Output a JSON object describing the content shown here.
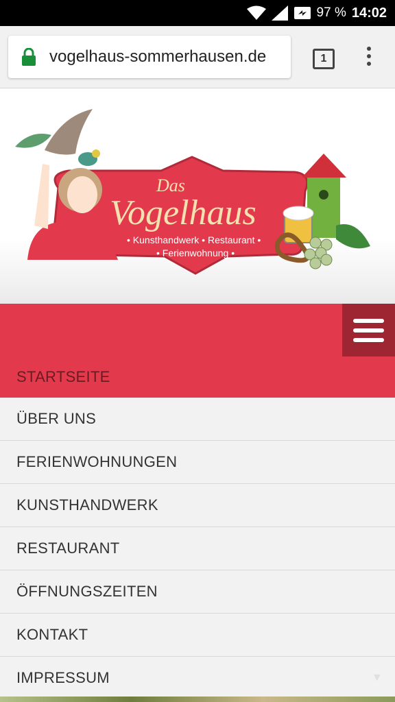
{
  "status_bar": {
    "battery": "97 %",
    "time": "14:02"
  },
  "browser": {
    "url": "vogelhaus-sommerhausen.de",
    "tab_count": "1"
  },
  "logo": {
    "title_small": "Das",
    "title_big": "Vogelhaus",
    "subtitle_line1": "• Kunsthandwerk • Restaurant •",
    "subtitle_line2": "• Ferienwohnung •"
  },
  "menu": {
    "items": [
      {
        "label": "STARTSEITE"
      },
      {
        "label": "ÜBER UNS"
      },
      {
        "label": "FERIENWOHNUNGEN"
      },
      {
        "label": "KUNSTHANDWERK"
      },
      {
        "label": "RESTAURANT"
      },
      {
        "label": "ÖFFNUNGSZEITEN"
      },
      {
        "label": "KONTAKT"
      },
      {
        "label": "IMPRESSUM"
      }
    ]
  }
}
